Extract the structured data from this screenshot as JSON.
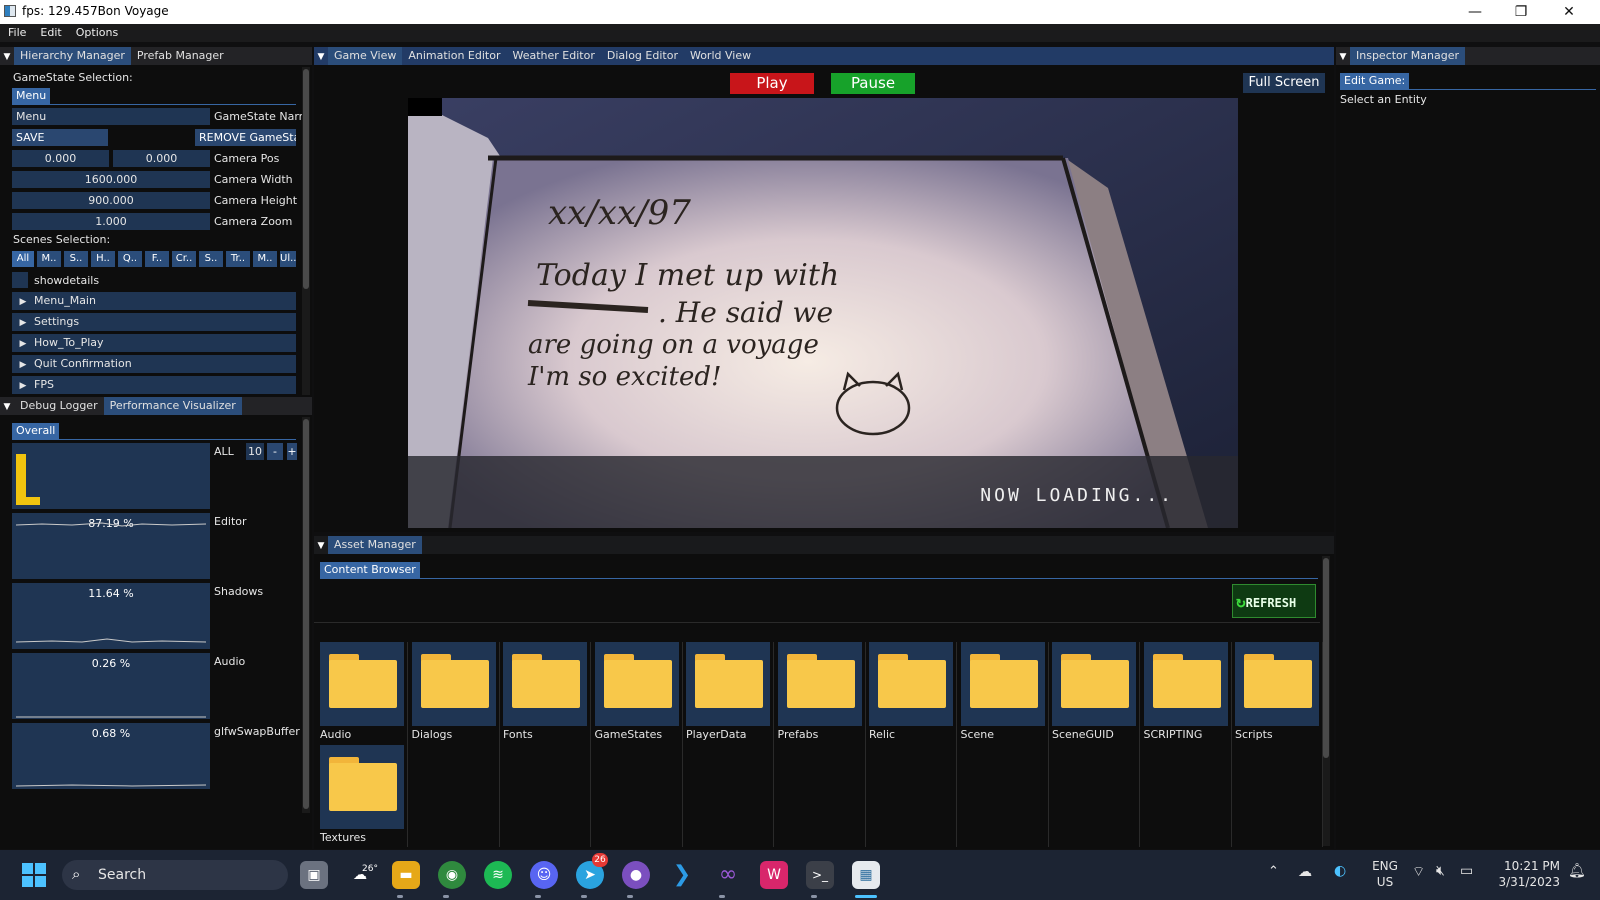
{
  "window": {
    "title": "fps: 129.457Bon Voyage",
    "controls": [
      "—",
      "❐",
      "✕"
    ]
  },
  "menubar": [
    "File",
    "Edit",
    "Options"
  ],
  "hierarchy": {
    "tabs": [
      "Hierarchy Manager",
      "Prefab Manager"
    ],
    "gamestate_selection_label": "GameState Selection:",
    "gamestate_chip": "Menu",
    "gamestate_name_value": "Menu",
    "gamestate_name_label": "GameState Narr",
    "save_button": "SAVE GameState",
    "remove_button": "REMOVE GameSta",
    "camera_pos_x": "0.000",
    "camera_pos_y": "0.000",
    "camera_pos_label": "Camera Pos",
    "camera_width_value": "1600.000",
    "camera_width_label": "Camera Width",
    "camera_height_value": "900.000",
    "camera_height_label": "Camera Height",
    "camera_zoom_value": "1.000",
    "camera_zoom_label": "Camera Zoom",
    "scenes_selection_label": "Scenes Selection:",
    "scene_chips": [
      "All",
      "M..",
      "S..",
      "H..",
      "Q..",
      "F..",
      "Cr..",
      "S..",
      "Tr..",
      "M..",
      "Ul.."
    ],
    "showdetails_label": "showdetails",
    "tree_items": [
      "Menu_Main",
      "Settings",
      "How_To_Play",
      "Quit Confirmation",
      "FPS"
    ]
  },
  "debug": {
    "tabs": [
      "Debug Logger",
      "Performance Visualizer"
    ],
    "overall_chip": "Overall",
    "all_label": "ALL",
    "count_value": "10",
    "minus": "-",
    "plus": "+",
    "graphs": [
      {
        "pct": "87.19 %",
        "label": "Editor"
      },
      {
        "pct": "11.64 %",
        "label": "Shadows"
      },
      {
        "pct": "0.26 %",
        "label": "Audio"
      },
      {
        "pct": "0.68 %",
        "label": "glfwSwapBuffer"
      }
    ]
  },
  "gameview": {
    "tabs": [
      "Game View",
      "Animation Editor",
      "Weather Editor",
      "Dialog Editor",
      "World View"
    ],
    "play": "Play",
    "pause": "Pause",
    "fullscreen": "Full Screen",
    "diary": {
      "date": "xx/xx/97",
      "line1": "Today I met up with",
      "line2": ". He said we",
      "line3": "are going on a voyage",
      "line4": "I'm so excited!"
    },
    "loading": "NOW LOADING..."
  },
  "inspector": {
    "tab": "Inspector Manager",
    "edit_chip": "Edit Game:",
    "hint": "Select an Entity"
  },
  "assets": {
    "tab": "Asset Manager",
    "subtab": "Content Browser",
    "refresh": "REFRESH",
    "folders": [
      "Audio",
      "Dialogs",
      "Fonts",
      "GameStates",
      "PlayerData",
      "Prefabs",
      "Relic",
      "Scene",
      "SceneGUID",
      "SCRIPTING",
      "Scripts",
      "Textures"
    ]
  },
  "taskbar": {
    "search_placeholder": "Search",
    "weather_badge": "26°",
    "telegram_badge": "26",
    "language": "ENG",
    "region": "US",
    "time": "10:21 PM",
    "date": "3/31/2023"
  },
  "colors": {
    "play": "#c8151a",
    "pause": "#17a22a",
    "accent": "#2b4d7a",
    "field": "#1f3553",
    "folder": "#f8c84a"
  }
}
